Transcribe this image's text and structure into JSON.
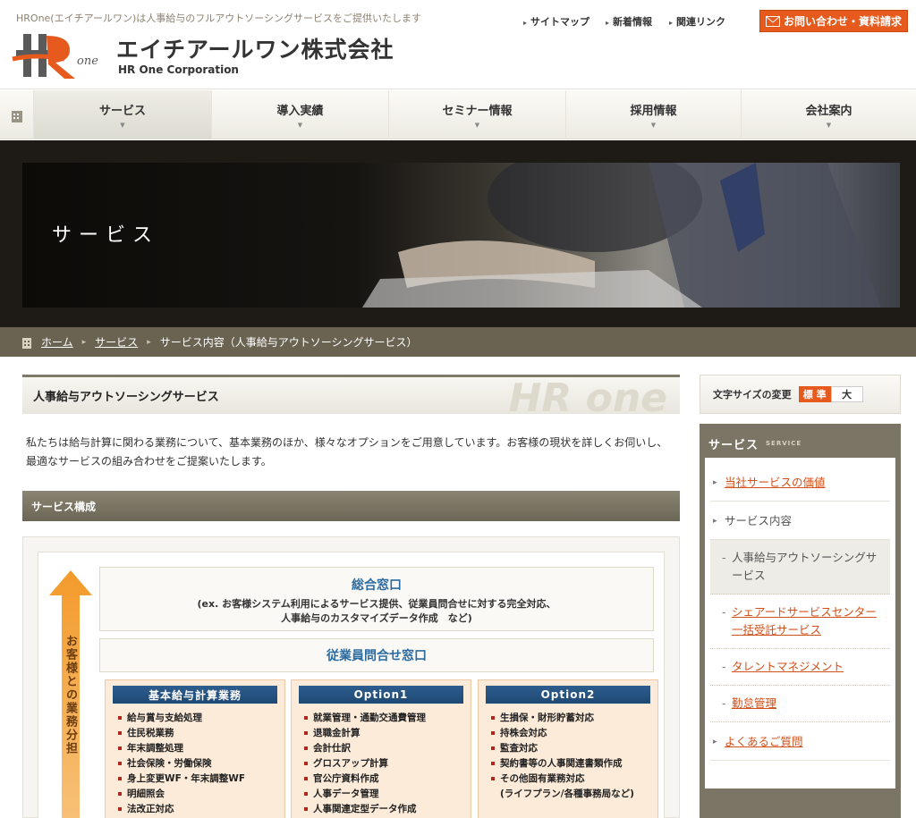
{
  "header": {
    "tagline": "HROne(エイチアールワン)は人事給与のフルアウトソーシングサービスをご提供いたします",
    "logo_text": "HR one",
    "company_name_jp": "エイチアールワン株式会社",
    "company_name_en": "HR One Corporation",
    "util_links": [
      "サイトマップ",
      "新着情報",
      "関連リンク"
    ],
    "contact_label": "お問い合わせ・資料請求"
  },
  "nav": {
    "items": [
      "サービス",
      "導入実績",
      "セミナー情報",
      "採用情報",
      "会社案内"
    ],
    "active_index": 0
  },
  "hero": {
    "title": "サービス"
  },
  "breadcrumb": {
    "home": "ホーム",
    "service": "サービス",
    "current": "サービス内容（人事給与アウトソーシングサービス）"
  },
  "main": {
    "heading": "人事給与アウトソーシングサービス",
    "watermark": "HR one",
    "intro": "私たちは給与計算に関わる業務について、基本業務のほか、様々なオプションをご用意しています。お客様の現状を詳しくお伺いし、最適なサービスの組み合わせをご提案いたします。",
    "section_heading": "サービス構成"
  },
  "diagram": {
    "arrow_label": "お客様との業務分担",
    "main_window_title": "総合窓口",
    "main_window_sub1": "(ex. お客様システム利用によるサービス提供、従業員問合せに対する完全対応、",
    "main_window_sub2": "人事給与のカスタマイズデータ作成　など)",
    "employee_window": "従業員問合せ窓口",
    "columns": [
      {
        "title": "基本給与計算業務",
        "items": [
          "給与賞与支給処理",
          "住民税業務",
          "年末調整処理",
          "社会保険・労働保険",
          "身上変更WF・年末調整WF",
          "明細照会",
          "法改正対応"
        ]
      },
      {
        "title": "Option1",
        "items": [
          "就業管理・通勤交通費管理",
          "退職金計算",
          "会計仕訳",
          "グロスアップ計算",
          "官公庁資料作成",
          "人事データ管理",
          "人事関連定型データ作成"
        ]
      },
      {
        "title": "Option2",
        "items": [
          "生損保・財形貯蓄対応",
          "持株会対応",
          "監査対応",
          "契約書等の人事関連書類作成",
          "その他固有業務対応",
          "(ライフプラン/各種事務局など)"
        ]
      }
    ]
  },
  "sidebar": {
    "font_size_label": "文字サイズの変更",
    "font_size_standard": "標 準",
    "font_size_large": "大",
    "service_heading": "サービス",
    "service_heading_en": "SERVICE",
    "items": [
      {
        "label": "当社サービスの価値",
        "level": 1,
        "link": true
      },
      {
        "label": "サービス内容",
        "level": 1,
        "link": false
      },
      {
        "label": "人事給与アウトソーシングサービス",
        "level": 2,
        "link": false,
        "current": true
      },
      {
        "label": "シェアードサービスセンター一括受託サービス",
        "level": 2,
        "link": true
      },
      {
        "label": "タレントマネジメント",
        "level": 2,
        "link": true
      },
      {
        "label": "勤怠管理",
        "level": 2,
        "link": true
      },
      {
        "label": "よくあるご質問",
        "level": 1,
        "link": true
      }
    ]
  },
  "colors": {
    "accent_orange": "#e65a1e",
    "nav_brown": "#6a6352",
    "link_blue_heading": "#2c6ba0",
    "option_header_blue": "#1e4873"
  }
}
